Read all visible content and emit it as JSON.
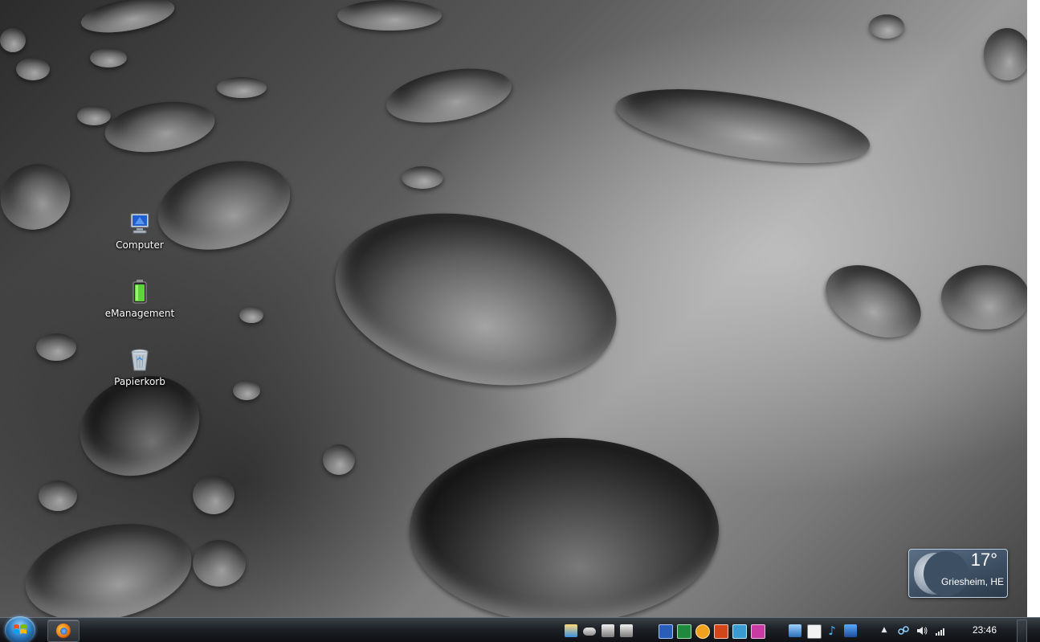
{
  "desktop": {
    "icons": [
      {
        "label": "Computer",
        "icon": "computer-icon"
      },
      {
        "label": "eManagement",
        "icon": "battery-icon"
      },
      {
        "label": "Papierkorb",
        "icon": "recycle-bin-icon"
      }
    ]
  },
  "weather_gadget": {
    "temperature": "17°",
    "location": "Griesheim, HE"
  },
  "taskbar": {
    "start_icon": "windows-start-icon",
    "pinned": [
      {
        "name": "firefox-icon"
      }
    ],
    "quick_launch": [
      "explorer-tools-icon",
      "drive-icon",
      "network-drive-icon",
      "network-drive-2-icon",
      "word-icon",
      "excel-icon",
      "outlook-icon",
      "powerpoint-icon",
      "publisher-icon",
      "onenote-icon",
      "window-icon",
      "document-icon",
      "music-icon",
      "media-icon"
    ],
    "tray": {
      "overflow_icon": "tray-arrow-icon",
      "icons": [
        "network-icon",
        "volume-icon",
        "signal-icon"
      ],
      "time": "23:46"
    }
  },
  "colors": {
    "taskbar_bg": "#1d2126",
    "gadget_bg": "#3d4f63",
    "accent_blue": "#2f7fc4"
  }
}
